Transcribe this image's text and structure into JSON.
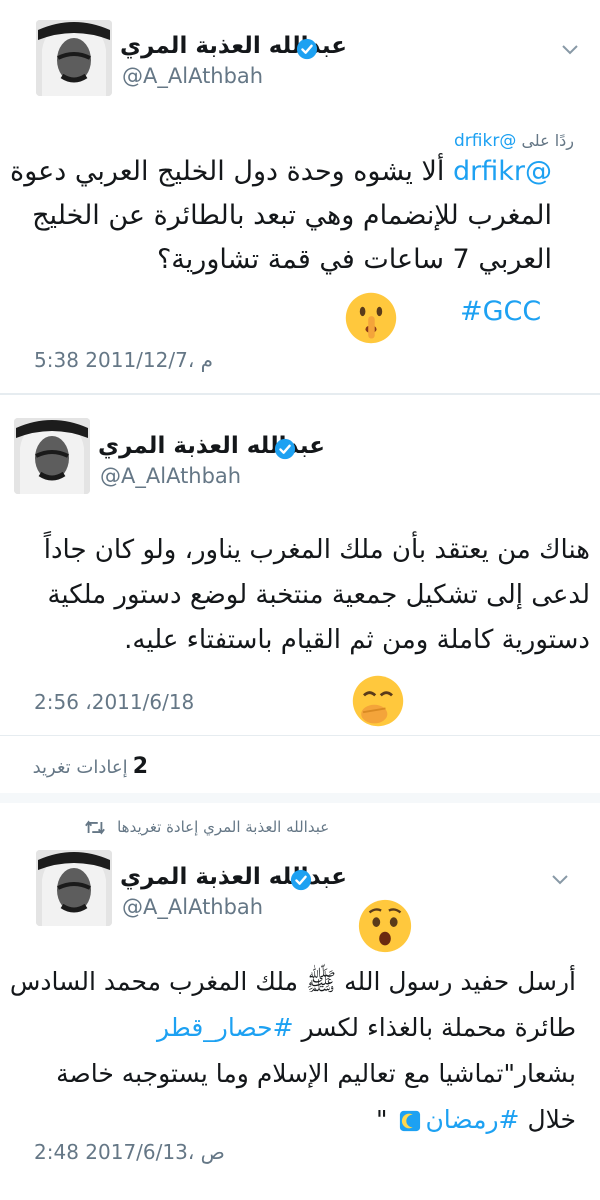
{
  "tweets": [
    {
      "author_name": "عبدالله العذبة المري",
      "handle": "@A_AlAthbah",
      "replying_prefix": "ردًا على",
      "replying_handle": "@drfikr",
      "body_mention": "@drfikr",
      "body_line1": " ألا يشوه وحدة دول الخليج العربي دعوة",
      "body_line2": "المغرب للإنضمام وهي تبعد بالطائرة عن الخليج",
      "body_line3": "العربي 7 ساعات في قمة تشاورية؟",
      "hashtag": "#GCC",
      "emoji": "shushing-face",
      "timestamp": "5:38 م ،2011/12/7"
    },
    {
      "author_name": "عبدالله العذبة المري",
      "handle": "@A_AlAthbah",
      "body_line1": "هناك من يعتقد بأن ملك المغرب يناور، ولو كان جاداً",
      "body_line2": "لدعى إلى تشكيل جمعية منتخبة لوضع دستور ملكية",
      "body_line3": "دستورية كاملة ومن ثم القيام باستفتاء عليه.",
      "emoji": "hand-over-mouth-face",
      "timestamp": "2:56 ،2011/6/18",
      "retweet_count": "2",
      "retweet_label": "إعادات تغريد"
    },
    {
      "retweeted_by": "عبدالله العذبة المري إعادة تغريدها",
      "author_name": "عبدالله العذبة المري",
      "handle": "@A_AlAthbah",
      "emoji": "astonished-face",
      "body_line1": "أرسل حفيد رسول الله ﷺ ملك المغرب محمد السادس",
      "body_line2_text": "طائرة محملة بالغذاء لكسر ",
      "body_line2_tag": "#حصار_قطر",
      "body_line3": "بشعار\"تماشيا مع تعاليم الإسلام وما يستوجبه خاصة",
      "body_line4_text": "خلال ",
      "body_line4_tag": "#رمضان",
      "body_line4_end": " \"",
      "timestamp": "2:48 ص ،2017/6/13"
    }
  ]
}
